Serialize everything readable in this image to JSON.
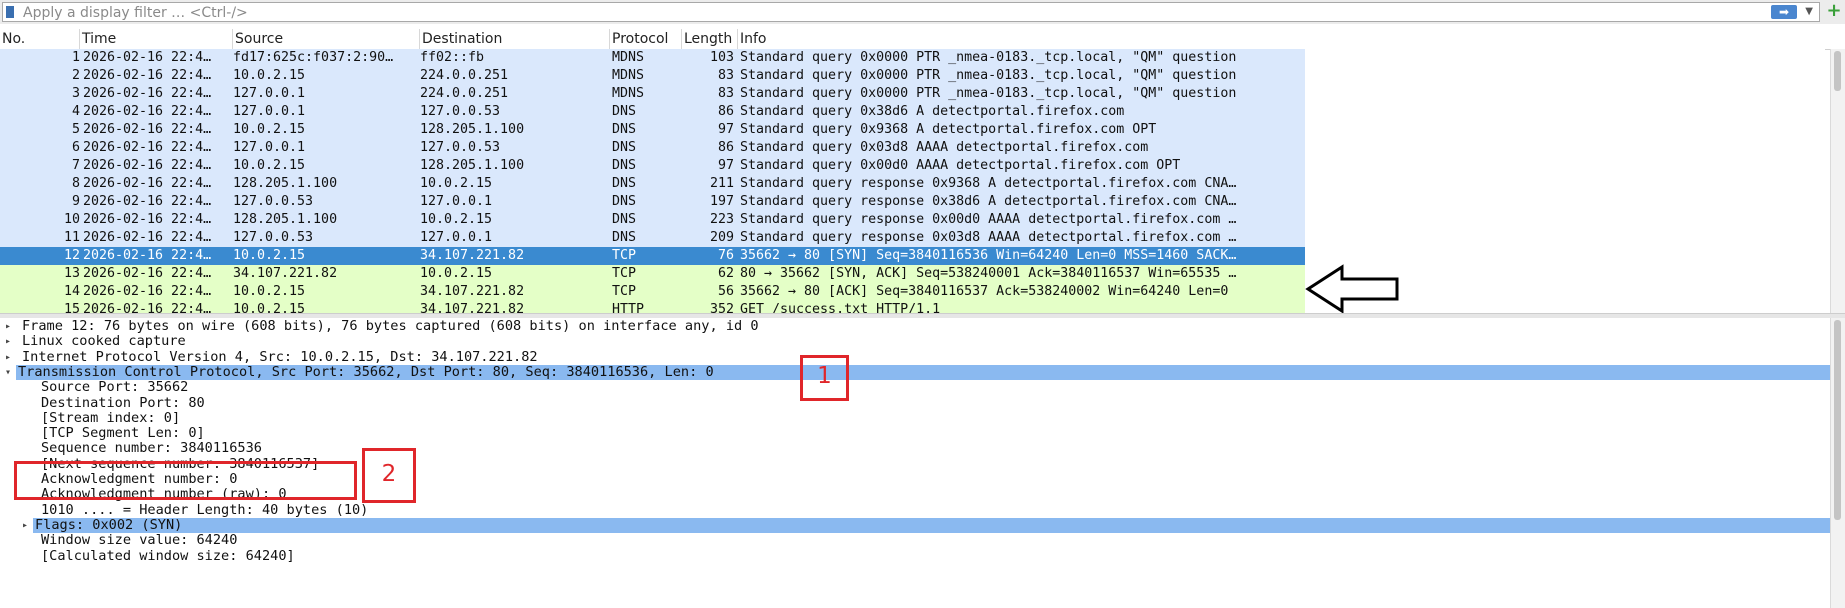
{
  "filter": {
    "placeholder": "Apply a display filter … <Ctrl-/>"
  },
  "columns": [
    "No.",
    "Time",
    "Source",
    "Destination",
    "Protocol",
    "Length",
    "Info"
  ],
  "packets": [
    {
      "no": "1",
      "time": "2026-02-16 22:4…",
      "src": "fd17:625c:f037:2:90…",
      "dst": "ff02::fb",
      "proto": "MDNS",
      "len": "103",
      "info": "Standard query 0x0000 PTR _nmea-0183._tcp.local, \"QM\" question",
      "kind": "dns"
    },
    {
      "no": "2",
      "time": "2026-02-16 22:4…",
      "src": "10.0.2.15",
      "dst": "224.0.0.251",
      "proto": "MDNS",
      "len": "83",
      "info": "Standard query 0x0000 PTR _nmea-0183._tcp.local, \"QM\" question",
      "kind": "dns"
    },
    {
      "no": "3",
      "time": "2026-02-16 22:4…",
      "src": "127.0.0.1",
      "dst": "224.0.0.251",
      "proto": "MDNS",
      "len": "83",
      "info": "Standard query 0x0000 PTR _nmea-0183._tcp.local, \"QM\" question",
      "kind": "dns"
    },
    {
      "no": "4",
      "time": "2026-02-16 22:4…",
      "src": "127.0.0.1",
      "dst": "127.0.0.53",
      "proto": "DNS",
      "len": "86",
      "info": "Standard query 0x38d6 A detectportal.firefox.com",
      "kind": "dns"
    },
    {
      "no": "5",
      "time": "2026-02-16 22:4…",
      "src": "10.0.2.15",
      "dst": "128.205.1.100",
      "proto": "DNS",
      "len": "97",
      "info": "Standard query 0x9368 A detectportal.firefox.com OPT",
      "kind": "dns"
    },
    {
      "no": "6",
      "time": "2026-02-16 22:4…",
      "src": "127.0.0.1",
      "dst": "127.0.0.53",
      "proto": "DNS",
      "len": "86",
      "info": "Standard query 0x03d8 AAAA detectportal.firefox.com",
      "kind": "dns"
    },
    {
      "no": "7",
      "time": "2026-02-16 22:4…",
      "src": "10.0.2.15",
      "dst": "128.205.1.100",
      "proto": "DNS",
      "len": "97",
      "info": "Standard query 0x00d0 AAAA detectportal.firefox.com OPT",
      "kind": "dns"
    },
    {
      "no": "8",
      "time": "2026-02-16 22:4…",
      "src": "128.205.1.100",
      "dst": "10.0.2.15",
      "proto": "DNS",
      "len": "211",
      "info": "Standard query response 0x9368 A detectportal.firefox.com CNA…",
      "kind": "dns"
    },
    {
      "no": "9",
      "time": "2026-02-16 22:4…",
      "src": "127.0.0.53",
      "dst": "127.0.0.1",
      "proto": "DNS",
      "len": "197",
      "info": "Standard query response 0x38d6 A detectportal.firefox.com CNA…",
      "kind": "dns"
    },
    {
      "no": "10",
      "time": "2026-02-16 22:4…",
      "src": "128.205.1.100",
      "dst": "10.0.2.15",
      "proto": "DNS",
      "len": "223",
      "info": "Standard query response 0x00d0 AAAA detectportal.firefox.com …",
      "kind": "dns"
    },
    {
      "no": "11",
      "time": "2026-02-16 22:4…",
      "src": "127.0.0.53",
      "dst": "127.0.0.1",
      "proto": "DNS",
      "len": "209",
      "info": "Standard query response 0x03d8 AAAA detectportal.firefox.com …",
      "kind": "dns"
    },
    {
      "no": "12",
      "time": "2026-02-16 22:4…",
      "src": "10.0.2.15",
      "dst": "34.107.221.82",
      "proto": "TCP",
      "len": "76",
      "info": "35662 → 80 [SYN] Seq=3840116536 Win=64240 Len=0 MSS=1460 SACK…",
      "kind": "selected"
    },
    {
      "no": "13",
      "time": "2026-02-16 22:4…",
      "src": "34.107.221.82",
      "dst": "10.0.2.15",
      "proto": "TCP",
      "len": "62",
      "info": "80 → 35662 [SYN, ACK] Seq=538240001 Ack=3840116537 Win=65535 …",
      "kind": "tcp"
    },
    {
      "no": "14",
      "time": "2026-02-16 22:4…",
      "src": "10.0.2.15",
      "dst": "34.107.221.82",
      "proto": "TCP",
      "len": "56",
      "info": "35662 → 80 [ACK] Seq=3840116537 Ack=538240002 Win=64240 Len=0",
      "kind": "tcp"
    },
    {
      "no": "15",
      "time": "2026-02-16 22:4…",
      "src": "10.0.2.15",
      "dst": "34.107.221.82",
      "proto": "HTTP",
      "len": "352",
      "info": "GET /success.txt HTTP/1.1",
      "kind": "http"
    }
  ],
  "details": [
    {
      "text": "Frame 12: 76 bytes on wire (608 bits), 76 bytes captured (608 bits) on interface any, id 0",
      "indent": 0,
      "twisty": "▸",
      "hl": false
    },
    {
      "text": "Linux cooked capture",
      "indent": 0,
      "twisty": "▸",
      "hl": false
    },
    {
      "text": "Internet Protocol Version 4, Src: 10.0.2.15, Dst: 34.107.221.82",
      "indent": 0,
      "twisty": "▸",
      "hl": false
    },
    {
      "text": "Transmission Control Protocol, Src Port: 35662, Dst Port: 80, Seq: 3840116536, Len: 0",
      "indent": 0,
      "twisty": "▾",
      "hl": true
    },
    {
      "text": "Source Port: 35662",
      "indent": 1,
      "twisty": "",
      "hl": false
    },
    {
      "text": "Destination Port: 80",
      "indent": 1,
      "twisty": "",
      "hl": false
    },
    {
      "text": "[Stream index: 0]",
      "indent": 1,
      "twisty": "",
      "hl": false
    },
    {
      "text": "[TCP Segment Len: 0]",
      "indent": 1,
      "twisty": "",
      "hl": false
    },
    {
      "text": "Sequence number: 3840116536",
      "indent": 1,
      "twisty": "",
      "hl": false
    },
    {
      "text": "[Next sequence number: 3840116537]",
      "indent": 1,
      "twisty": "",
      "hl": false
    },
    {
      "text": "Acknowledgment number: 0",
      "indent": 1,
      "twisty": "",
      "hl": false
    },
    {
      "text": "Acknowledgment number (raw): 0",
      "indent": 1,
      "twisty": "",
      "hl": false
    },
    {
      "text": "1010 .... = Header Length: 40 bytes (10)",
      "indent": 1,
      "twisty": "",
      "hl": false
    },
    {
      "text": "Flags: 0x002 (SYN)",
      "indent": 1,
      "twisty": "▸",
      "hl": true
    },
    {
      "text": "Window size value: 64240",
      "indent": 1,
      "twisty": "",
      "hl": false
    },
    {
      "text": "[Calculated window size: 64240]",
      "indent": 1,
      "twisty": "",
      "hl": false
    }
  ],
  "annotations": {
    "label1": "1",
    "label2": "2"
  }
}
